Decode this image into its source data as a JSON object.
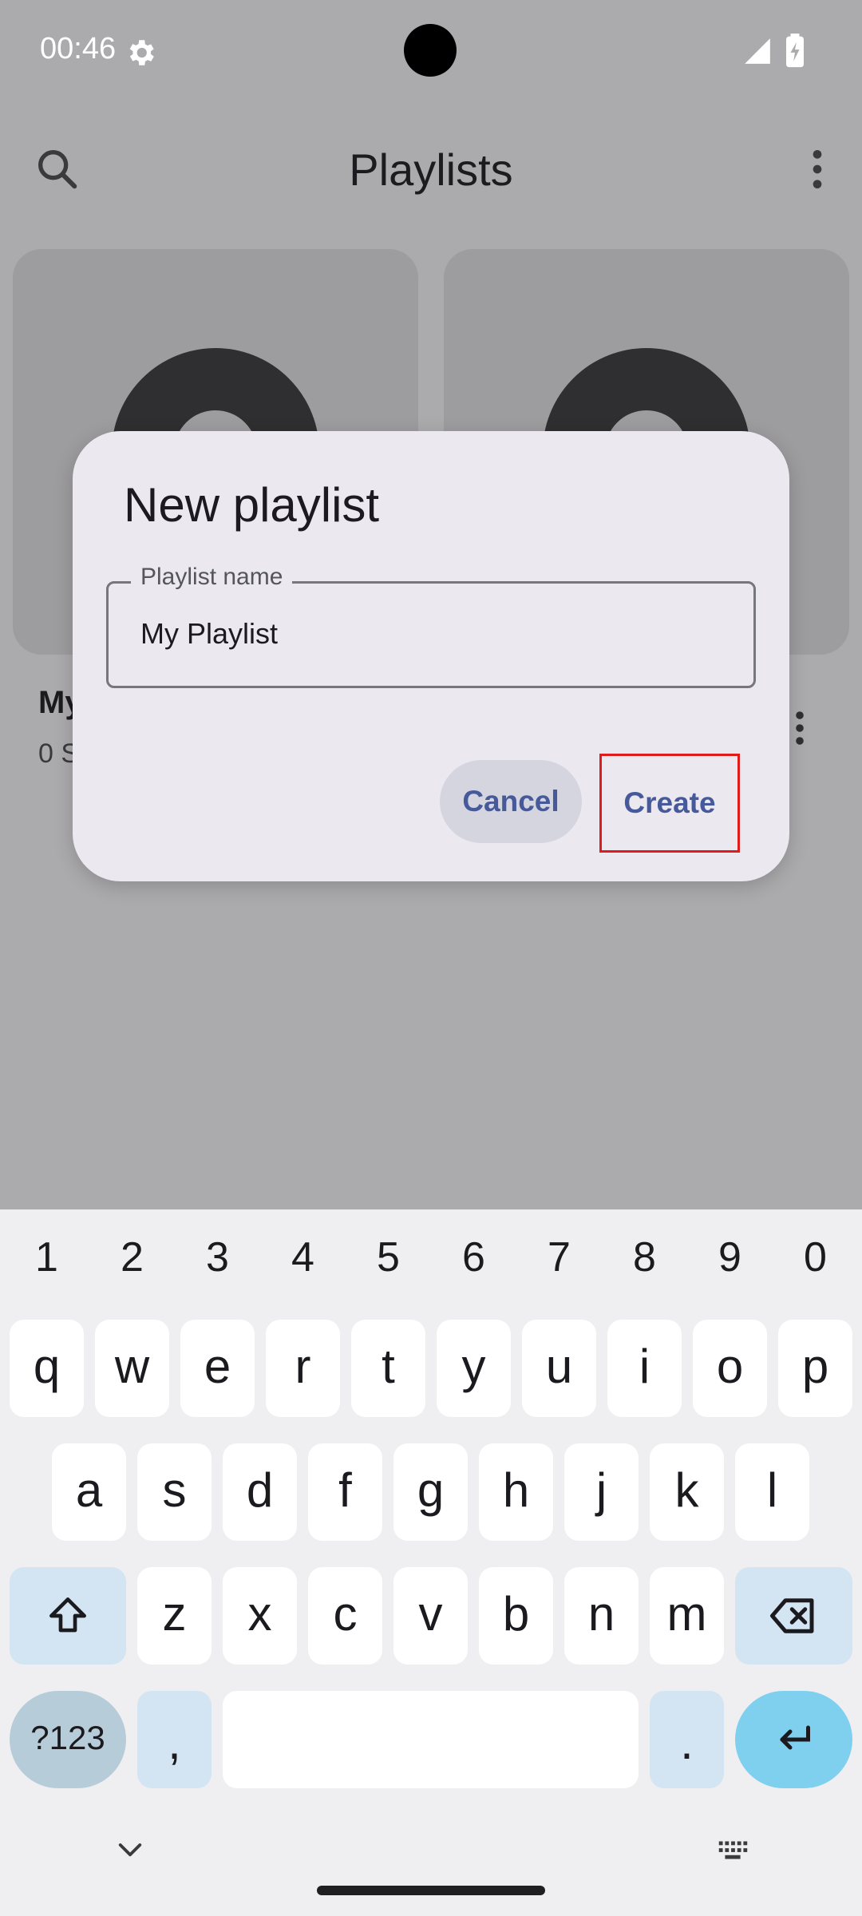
{
  "status_bar": {
    "time": "00:46"
  },
  "app_bar": {
    "title": "Playlists"
  },
  "playlists": [
    {
      "title": "My",
      "subtitle": "0 S"
    }
  ],
  "dialog": {
    "title": "New playlist",
    "field_label": "Playlist name",
    "field_value": "My Playlist",
    "cancel_label": "Cancel",
    "create_label": "Create"
  },
  "keyboard": {
    "numbers": [
      "1",
      "2",
      "3",
      "4",
      "5",
      "6",
      "7",
      "8",
      "9",
      "0"
    ],
    "row1": [
      "q",
      "w",
      "e",
      "r",
      "t",
      "y",
      "u",
      "i",
      "o",
      "p"
    ],
    "row2": [
      "a",
      "s",
      "d",
      "f",
      "g",
      "h",
      "j",
      "k",
      "l"
    ],
    "row3": [
      "z",
      "x",
      "c",
      "v",
      "b",
      "n",
      "m"
    ],
    "symbols_label": "?123",
    "comma": ",",
    "period": "."
  },
  "colors": {
    "scrim": "#abaaad",
    "dialog_bg": "#ebe9ef",
    "button_text": "#45599b",
    "highlight": "#e01b1b",
    "enter_key": "#7fcfee"
  }
}
